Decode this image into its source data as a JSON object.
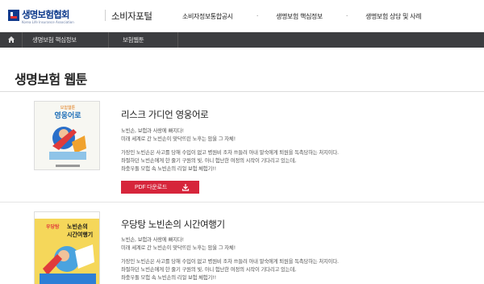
{
  "header": {
    "logo_text": "생명보험협회",
    "logo_sub": "Korea Life Insurance Association",
    "portal": "소비자포털",
    "nav": [
      "소비자정보통합공시",
      "생명보험 핵심정보",
      "생명보험 상담 및 사례"
    ],
    "dot": "·"
  },
  "breadcrumb": {
    "items": [
      "생명보험 핵심정보",
      "보험웹툰"
    ]
  },
  "page": {
    "title": "생명보험 웹툰"
  },
  "items": [
    {
      "cover_top": "보험웹툰",
      "cover_title": "영웅어로",
      "title": "리스크 가디언 영웅어로",
      "lines": [
        "노빈손, 보험과 사랑에 빠지다!",
        "미래 세계로 간 노빈손이 맞닥뜨린 노후는 암울 그 자체!",
        "가장인 노빈손은 사고를 당해 수입이 없고 병원비 조차 쓰들려 아내 말숙에게 퇴원을 독촉당하는 처지이다.",
        "좌절하던 노빈손에게 한 줄기 구원의 빛, 아니 험난한 여정의 시작이 기다리고 있는데,",
        "좌충우돌 모험 속 노빈손의 리얼 보험 체험기!!"
      ],
      "pdf_label": "PDF 다운로드"
    },
    {
      "cover_top": "우당탕",
      "cover_title": "노빈손의 시간여행기",
      "title": "우당탕 노빈손의 시간여행기",
      "lines": [
        "노빈손, 보험과 사랑에 빠지다!",
        "미래 세계로 간 노빈손이 맞닥뜨린 노후는 암울 그 자체!",
        "가장인 노빈손은 사고를 당해 수입이 없고 병원비 조차 쓰들려 아내 말숙에게 퇴원을 독촉당하는 처지이다.",
        "좌절하던 노빈손에게 한 줄기 구원의 빛, 아니 험난한 여정의 시작이 기다리고 있는데,",
        "좌충우돌 모험 속 노빈손의 리얼 보험 체험기!!"
      ]
    }
  ],
  "colors": {
    "brand_blue": "#0d3a8c",
    "breadcrumb_bg": "#3c3d40",
    "pdf_button": "#d6253b"
  },
  "icons": {
    "home": "home-icon",
    "download": "download-icon"
  }
}
